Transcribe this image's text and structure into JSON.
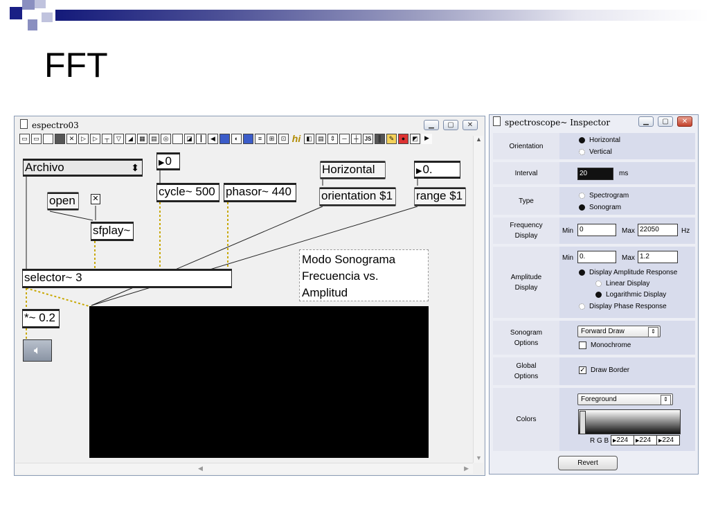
{
  "slide": {
    "title": "FFT"
  },
  "patcher": {
    "window_title": "espectro03",
    "toolbar_hi": "hi",
    "toolbar_js": "JS",
    "objects": {
      "umenu": "Archivo",
      "number_left": "0",
      "open_msg": "open",
      "sfplay": "sfplay~",
      "cycle": "cycle~ 500",
      "phasor": "phasor~ 440",
      "horizontal_msg": "Horizontal",
      "orientation_msg": "orientation $1",
      "flonum": "0.",
      "range_msg": "range $1",
      "selector": "selector~ 3",
      "mult": "*~ 0.2"
    },
    "comment_lines": [
      "Modo Sonograma",
      "Frecuencia vs.",
      "Amplitud"
    ]
  },
  "inspector": {
    "window_title": "spectroscope~ Inspector",
    "orientation": {
      "label": "Orientation",
      "options": [
        "Horizontal",
        "Vertical"
      ],
      "selected": "Horizontal"
    },
    "interval": {
      "label": "Interval",
      "value": "20",
      "unit": "ms"
    },
    "type": {
      "label": "Type",
      "options": [
        "Spectrogram",
        "Sonogram"
      ],
      "selected": "Sonogram"
    },
    "frequency": {
      "label_line1": "Frequency",
      "label_line2": "Display",
      "min_label": "Min",
      "min": "0",
      "max_label": "Max",
      "max": "22050",
      "unit": "Hz"
    },
    "amplitude": {
      "label_line1": "Amplitude",
      "label_line2": "Display",
      "min_label": "Min",
      "min": "0.",
      "max_label": "Max",
      "max": "1.2",
      "opt_amp": "Display Amplitude Response",
      "opt_linear": "Linear Display",
      "opt_log": "Logarithmic Display",
      "opt_phase": "Display Phase Response"
    },
    "sonogram": {
      "label_line1": "Sonogram",
      "label_line2": "Options",
      "mode": "Forward Draw",
      "monochrome": "Monochrome"
    },
    "global": {
      "label_line1": "Global",
      "label_line2": "Options",
      "draw_border": "Draw Border"
    },
    "colors": {
      "label": "Colors",
      "selected": "Foreground",
      "rgb_label": "R G B",
      "r": "224",
      "g": "224",
      "b": "224"
    },
    "revert": "Revert"
  }
}
